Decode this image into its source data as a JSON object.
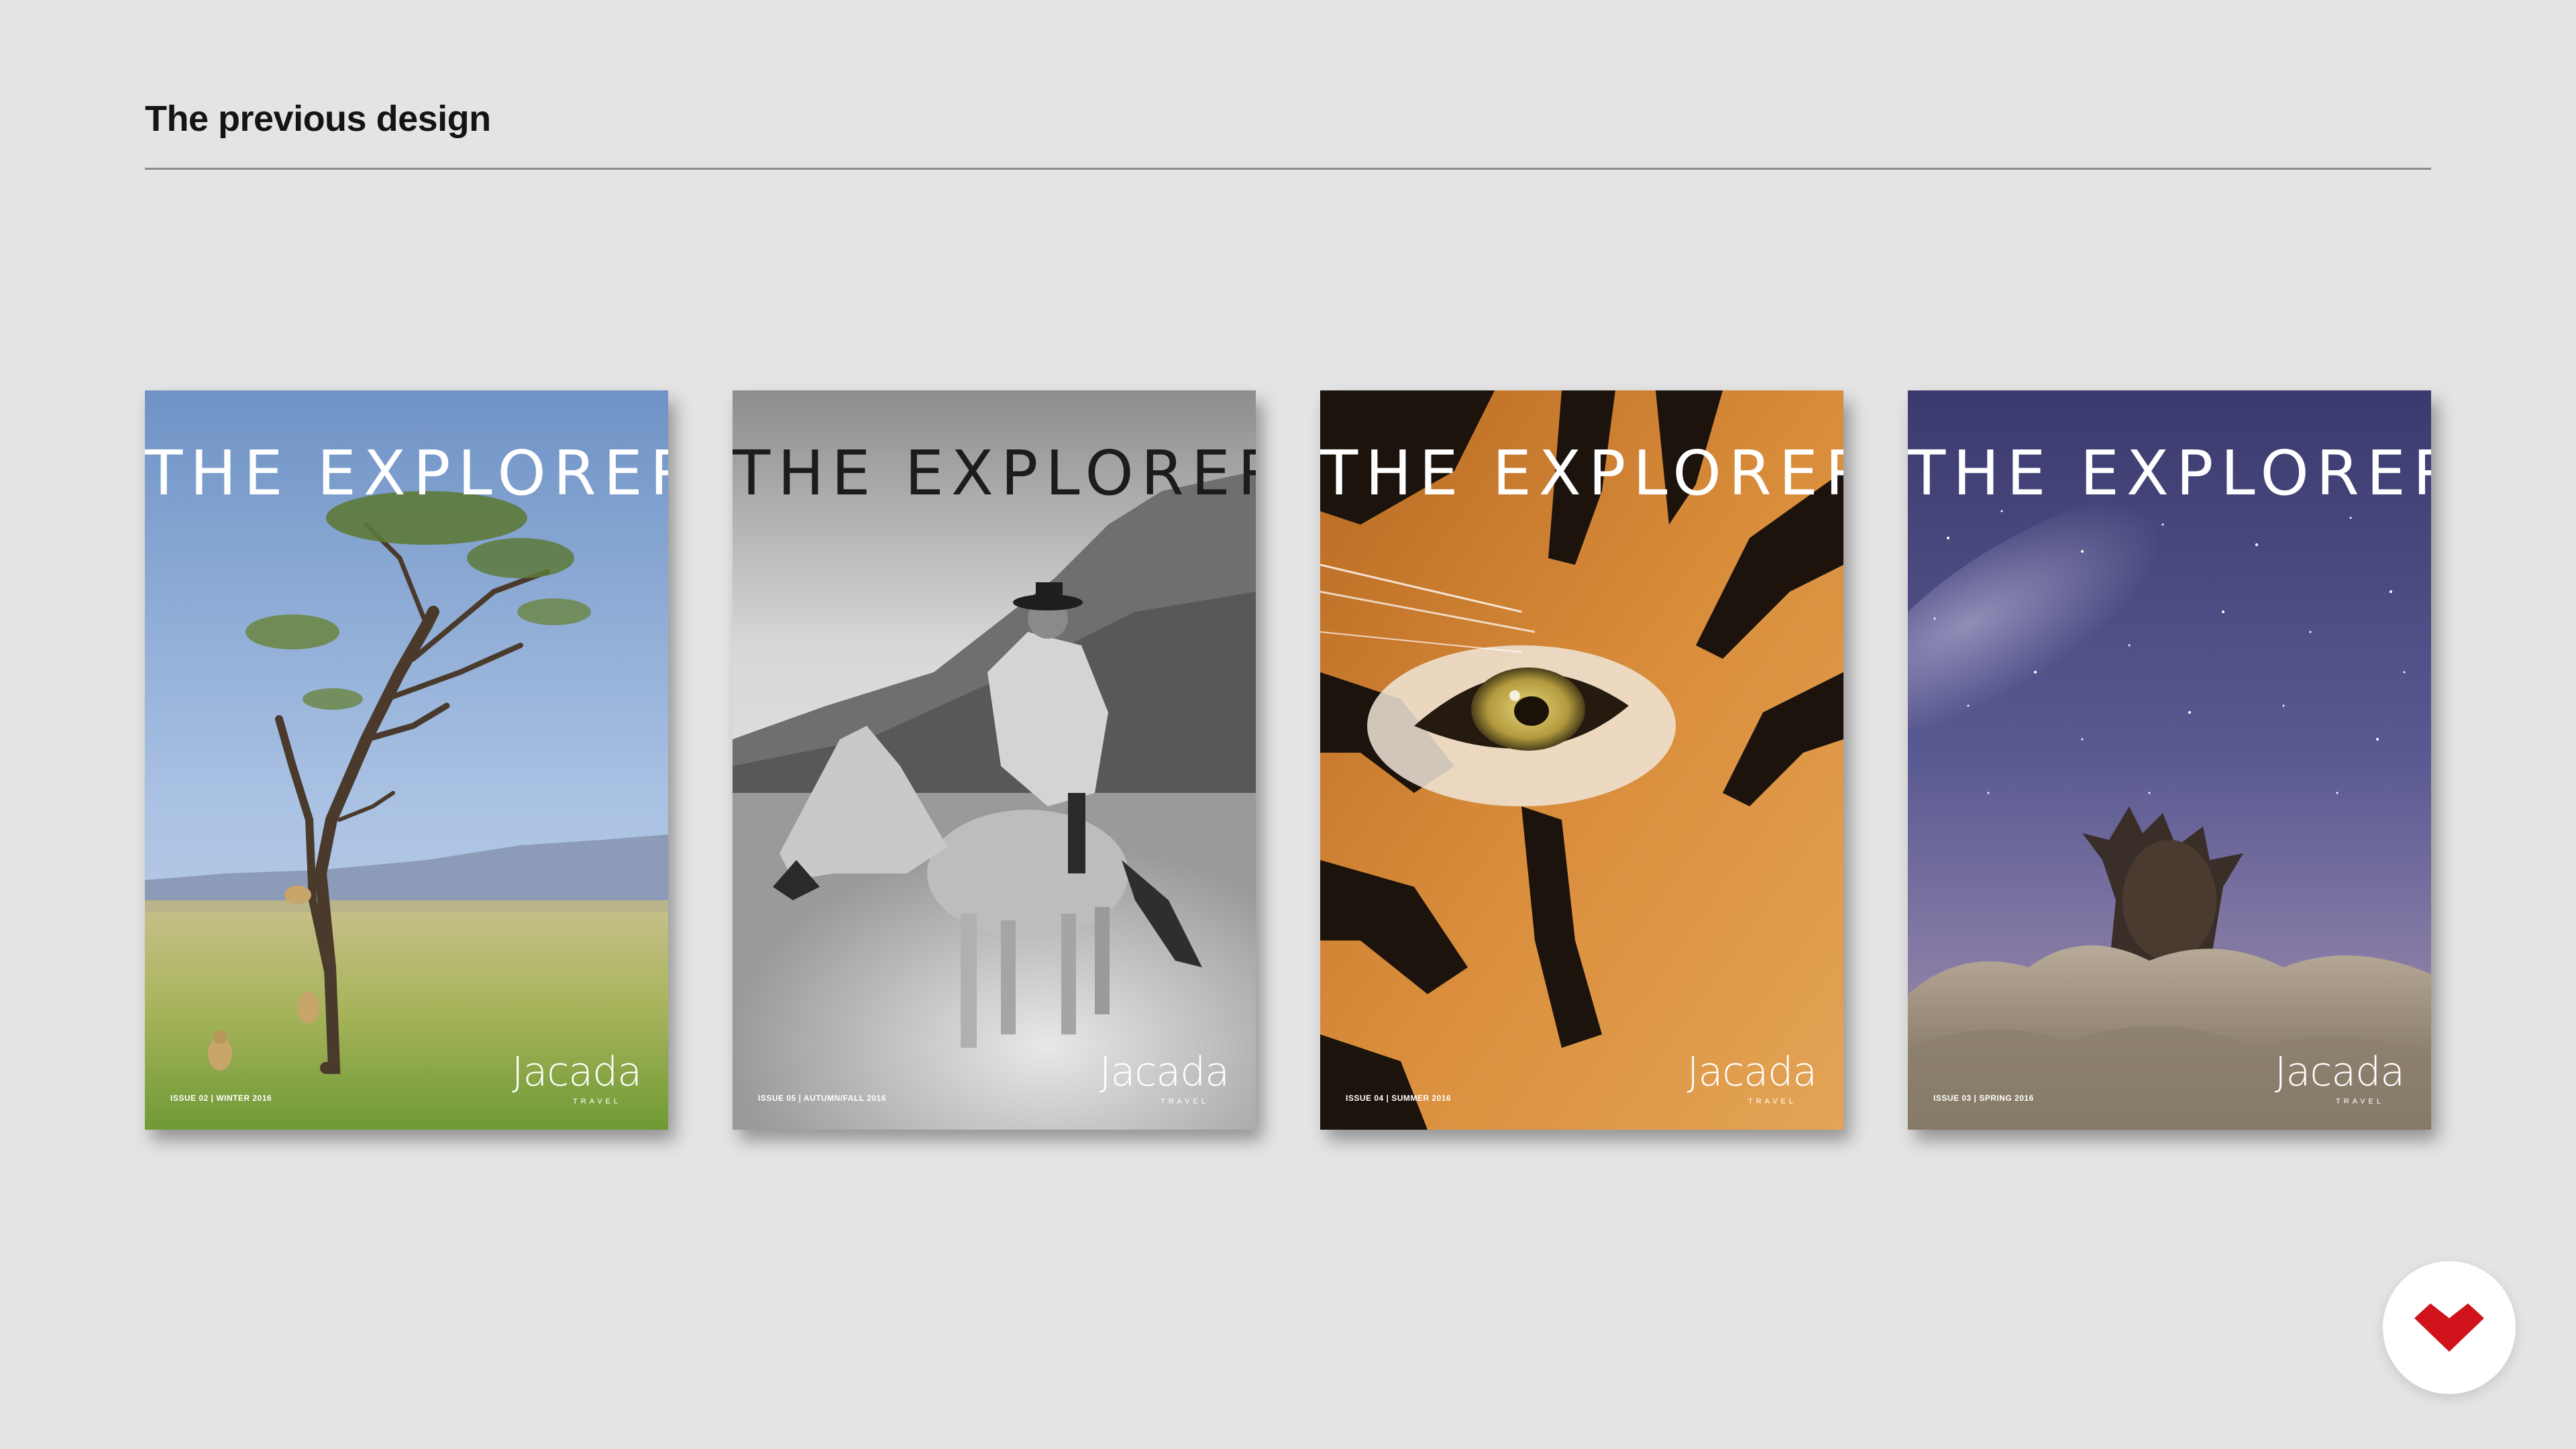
{
  "header": {
    "title": "The previous design"
  },
  "covers": [
    {
      "title": "THE EXPLORER",
      "issue": "ISSUE 02 | WINTER 2016",
      "brand": "Jacada",
      "brand_sub": "TRAVEL",
      "scene": "acacia-tree-savanna-cheetahs"
    },
    {
      "title": "THE EXPLORER",
      "issue": "ISSUE 05 | AUTUMN/FALL 2016",
      "brand": "Jacada",
      "brand_sub": "TRAVEL",
      "scene": "gaucho-on-horse-black-and-white"
    },
    {
      "title": "THE EXPLORER",
      "issue": "ISSUE 04 | SUMMER 2016",
      "brand": "Jacada",
      "brand_sub": "TRAVEL",
      "scene": "tiger-eye-closeup"
    },
    {
      "title": "THE EXPLORER",
      "issue": "ISSUE 03 | SPRING 2016",
      "brand": "Jacada",
      "brand_sub": "TRAVEL",
      "scene": "baobab-under-milky-way"
    }
  ],
  "badge": {
    "icon": "brand-chevron-icon",
    "color": "#d0121b"
  }
}
